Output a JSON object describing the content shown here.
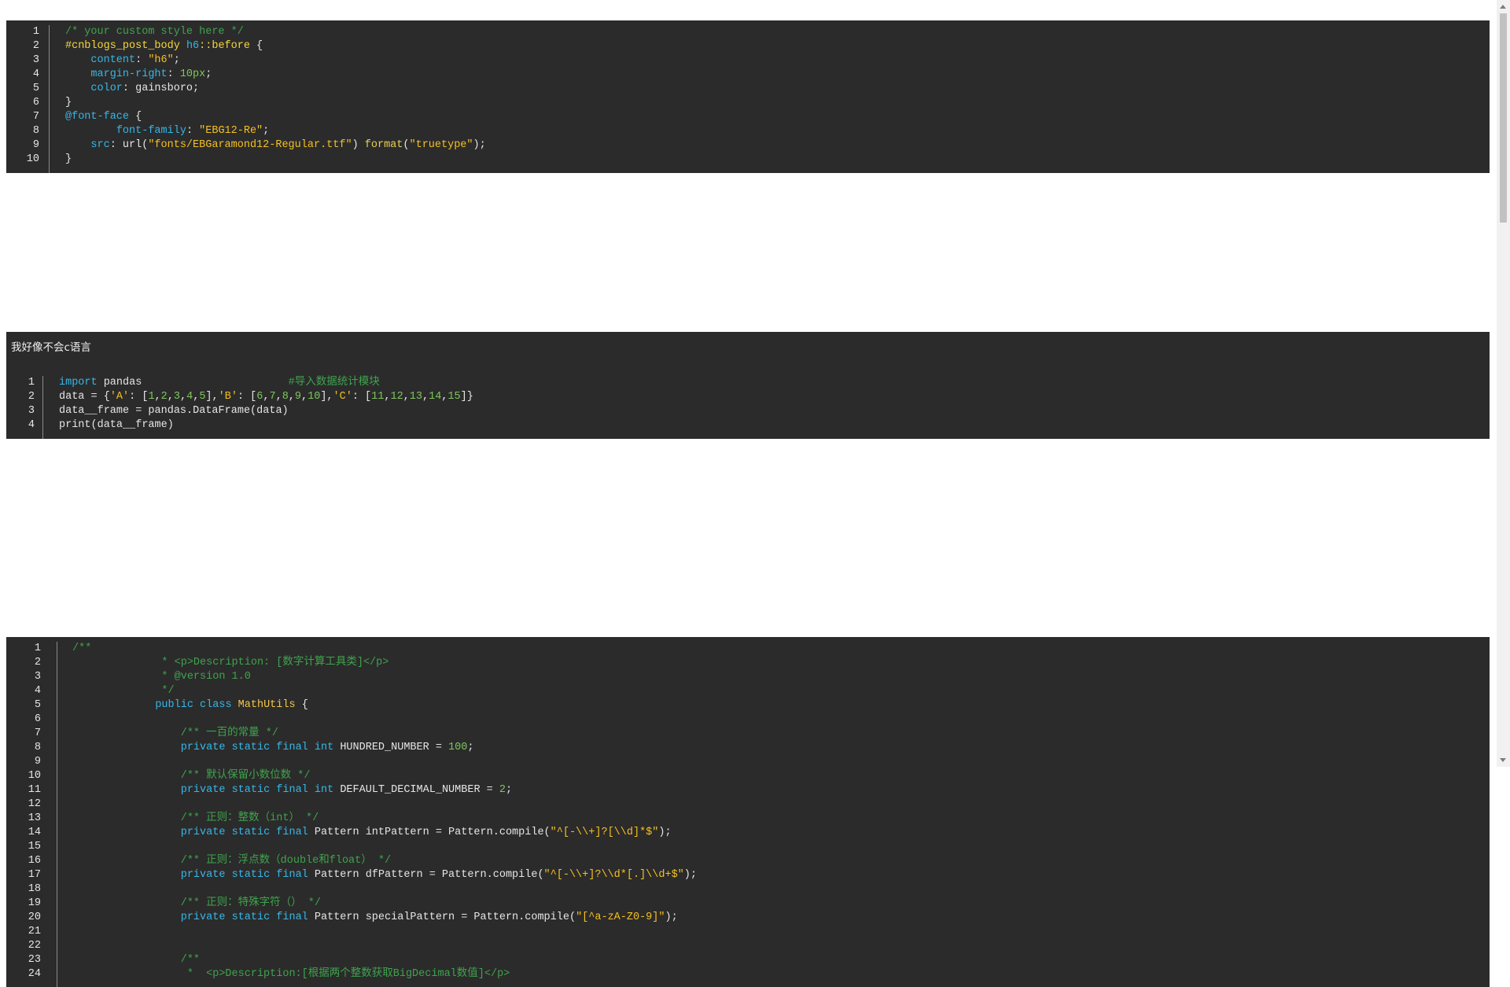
{
  "css_block": {
    "numbers": [
      "1",
      "2",
      "3",
      "4",
      "5",
      "6",
      "7",
      "8",
      "9",
      "10"
    ],
    "lines": [
      [
        [
          "c",
          "/* your custom style here */"
        ]
      ],
      [
        [
          "sel",
          "#cnblogs_post_body "
        ],
        [
          "k",
          "h6"
        ],
        [
          "sel",
          "::before"
        ],
        [
          "p",
          " {"
        ]
      ],
      [
        [
          "p",
          "    "
        ],
        [
          "k",
          "content"
        ],
        [
          "p",
          ": "
        ],
        [
          "s",
          "\"h6\""
        ],
        [
          "p",
          ";"
        ]
      ],
      [
        [
          "p",
          "    "
        ],
        [
          "k",
          "margin-right"
        ],
        [
          "p",
          ": "
        ],
        [
          "n",
          "10px"
        ],
        [
          "p",
          ";"
        ]
      ],
      [
        [
          "p",
          "    "
        ],
        [
          "k",
          "color"
        ],
        [
          "p",
          ": gainsboro;"
        ]
      ],
      [
        [
          "p",
          "}"
        ]
      ],
      [
        [
          "at",
          "@font-face"
        ],
        [
          "p",
          " {"
        ]
      ],
      [
        [
          "p",
          "        "
        ],
        [
          "k",
          "font-family"
        ],
        [
          "p",
          ": "
        ],
        [
          "s",
          "\"EBG12-Re\""
        ],
        [
          "p",
          ";"
        ]
      ],
      [
        [
          "p",
          "    "
        ],
        [
          "k",
          "src"
        ],
        [
          "p",
          ": url("
        ],
        [
          "s",
          "\"fonts/EBGaramond12-Regular.ttf\""
        ],
        [
          "p",
          ") "
        ],
        [
          "fn",
          "format"
        ],
        [
          "p",
          "("
        ],
        [
          "s",
          "\"truetype\""
        ],
        [
          "p",
          ");"
        ]
      ],
      [
        [
          "p",
          "}"
        ]
      ]
    ]
  },
  "python_block": {
    "numbers": [
      "1",
      "2",
      "3",
      "4"
    ],
    "lines": [
      [
        [
          "k",
          "import"
        ],
        [
          "p",
          " pandas                       "
        ],
        [
          "c",
          "#导入数据统计模块"
        ]
      ],
      [
        [
          "p",
          "data = {"
        ],
        [
          "s",
          "'A'"
        ],
        [
          "p",
          ": ["
        ],
        [
          "n",
          "1"
        ],
        [
          "p",
          ","
        ],
        [
          "n",
          "2"
        ],
        [
          "p",
          ","
        ],
        [
          "n",
          "3"
        ],
        [
          "p",
          ","
        ],
        [
          "n",
          "4"
        ],
        [
          "p",
          ","
        ],
        [
          "n",
          "5"
        ],
        [
          "p",
          "],"
        ],
        [
          "s",
          "'B'"
        ],
        [
          "p",
          ": ["
        ],
        [
          "n",
          "6"
        ],
        [
          "p",
          ","
        ],
        [
          "n",
          "7"
        ],
        [
          "p",
          ","
        ],
        [
          "n",
          "8"
        ],
        [
          "p",
          ","
        ],
        [
          "n",
          "9"
        ],
        [
          "p",
          ","
        ],
        [
          "n",
          "10"
        ],
        [
          "p",
          "],"
        ],
        [
          "s",
          "'C'"
        ],
        [
          "p",
          ": ["
        ],
        [
          "n",
          "11"
        ],
        [
          "p",
          ","
        ],
        [
          "n",
          "12"
        ],
        [
          "p",
          ","
        ],
        [
          "n",
          "13"
        ],
        [
          "p",
          ","
        ],
        [
          "n",
          "14"
        ],
        [
          "p",
          ","
        ],
        [
          "n",
          "15"
        ],
        [
          "p",
          "]}"
        ]
      ],
      [
        [
          "p",
          "data__frame = pandas.DataFrame(data)"
        ]
      ],
      [
        [
          "p",
          "print(data__frame)"
        ]
      ]
    ]
  },
  "note_block": {
    "text": "我好像不会c语言"
  },
  "java_block": {
    "numbers": [
      "1",
      "2",
      "3",
      "4",
      "5",
      "6",
      "7",
      "8",
      "9",
      "10",
      "11",
      "12",
      "13",
      "14",
      "15",
      "16",
      "17",
      "18",
      "19",
      "20",
      "21",
      "22",
      "23",
      "24"
    ],
    "lines": [
      [
        [
          "c",
          "/**"
        ]
      ],
      [
        [
          "p",
          "              "
        ],
        [
          "c",
          "* <p>Description: [数字计算工具类]</p>"
        ]
      ],
      [
        [
          "p",
          "              "
        ],
        [
          "c",
          "* @version 1.0"
        ]
      ],
      [
        [
          "p",
          "              "
        ],
        [
          "c",
          "*/"
        ]
      ],
      [
        [
          "p",
          "             "
        ],
        [
          "k",
          "public"
        ],
        [
          "p",
          " "
        ],
        [
          "k",
          "class"
        ],
        [
          "p",
          " "
        ],
        [
          "cls",
          "MathUtils"
        ],
        [
          "p",
          " {"
        ]
      ],
      [
        [
          "p",
          ""
        ]
      ],
      [
        [
          "p",
          "                 "
        ],
        [
          "c",
          "/** 一百的常量 */"
        ]
      ],
      [
        [
          "p",
          "                 "
        ],
        [
          "k",
          "private"
        ],
        [
          "p",
          " "
        ],
        [
          "k",
          "static"
        ],
        [
          "p",
          " "
        ],
        [
          "k",
          "final"
        ],
        [
          "p",
          " "
        ],
        [
          "k",
          "int"
        ],
        [
          "p",
          " HUNDRED_NUMBER = "
        ],
        [
          "n",
          "100"
        ],
        [
          "p",
          ";"
        ]
      ],
      [
        [
          "p",
          ""
        ]
      ],
      [
        [
          "p",
          "                 "
        ],
        [
          "c",
          "/** 默认保留小数位数 */"
        ]
      ],
      [
        [
          "p",
          "                 "
        ],
        [
          "k",
          "private"
        ],
        [
          "p",
          " "
        ],
        [
          "k",
          "static"
        ],
        [
          "p",
          " "
        ],
        [
          "k",
          "final"
        ],
        [
          "p",
          " "
        ],
        [
          "k",
          "int"
        ],
        [
          "p",
          " DEFAULT_DECIMAL_NUMBER = "
        ],
        [
          "n",
          "2"
        ],
        [
          "p",
          ";"
        ]
      ],
      [
        [
          "p",
          ""
        ]
      ],
      [
        [
          "p",
          "                 "
        ],
        [
          "c",
          "/** 正则：整数（int） */"
        ]
      ],
      [
        [
          "p",
          "                 "
        ],
        [
          "k",
          "private"
        ],
        [
          "p",
          " "
        ],
        [
          "k",
          "static"
        ],
        [
          "p",
          " "
        ],
        [
          "k",
          "final"
        ],
        [
          "p",
          " Pattern intPattern = Pattern.compile("
        ],
        [
          "s",
          "\"^[-\\\\+]?[\\\\d]*$\""
        ],
        [
          "p",
          ");"
        ]
      ],
      [
        [
          "p",
          ""
        ]
      ],
      [
        [
          "p",
          "                 "
        ],
        [
          "c",
          "/** 正则：浮点数（double和float） */"
        ]
      ],
      [
        [
          "p",
          "                 "
        ],
        [
          "k",
          "private"
        ],
        [
          "p",
          " "
        ],
        [
          "k",
          "static"
        ],
        [
          "p",
          " "
        ],
        [
          "k",
          "final"
        ],
        [
          "p",
          " Pattern dfPattern = Pattern.compile("
        ],
        [
          "s",
          "\"^[-\\\\+]?\\\\d*[.]\\\\d+$\""
        ],
        [
          "p",
          ");"
        ]
      ],
      [
        [
          "p",
          ""
        ]
      ],
      [
        [
          "p",
          "                 "
        ],
        [
          "c",
          "/** 正则：特殊字符（） */"
        ]
      ],
      [
        [
          "p",
          "                 "
        ],
        [
          "k",
          "private"
        ],
        [
          "p",
          " "
        ],
        [
          "k",
          "static"
        ],
        [
          "p",
          " "
        ],
        [
          "k",
          "final"
        ],
        [
          "p",
          " Pattern specialPattern = Pattern.compile("
        ],
        [
          "s",
          "\"[^a-zA-Z0-9]\""
        ],
        [
          "p",
          ");"
        ]
      ],
      [
        [
          "p",
          ""
        ]
      ],
      [
        [
          "p",
          ""
        ]
      ],
      [
        [
          "p",
          "                 "
        ],
        [
          "c",
          "/**"
        ]
      ],
      [
        [
          "p",
          "                  "
        ],
        [
          "c",
          "*  <p>Description:[根据两个整数获取BigDecimal数值]</p>"
        ]
      ]
    ]
  }
}
